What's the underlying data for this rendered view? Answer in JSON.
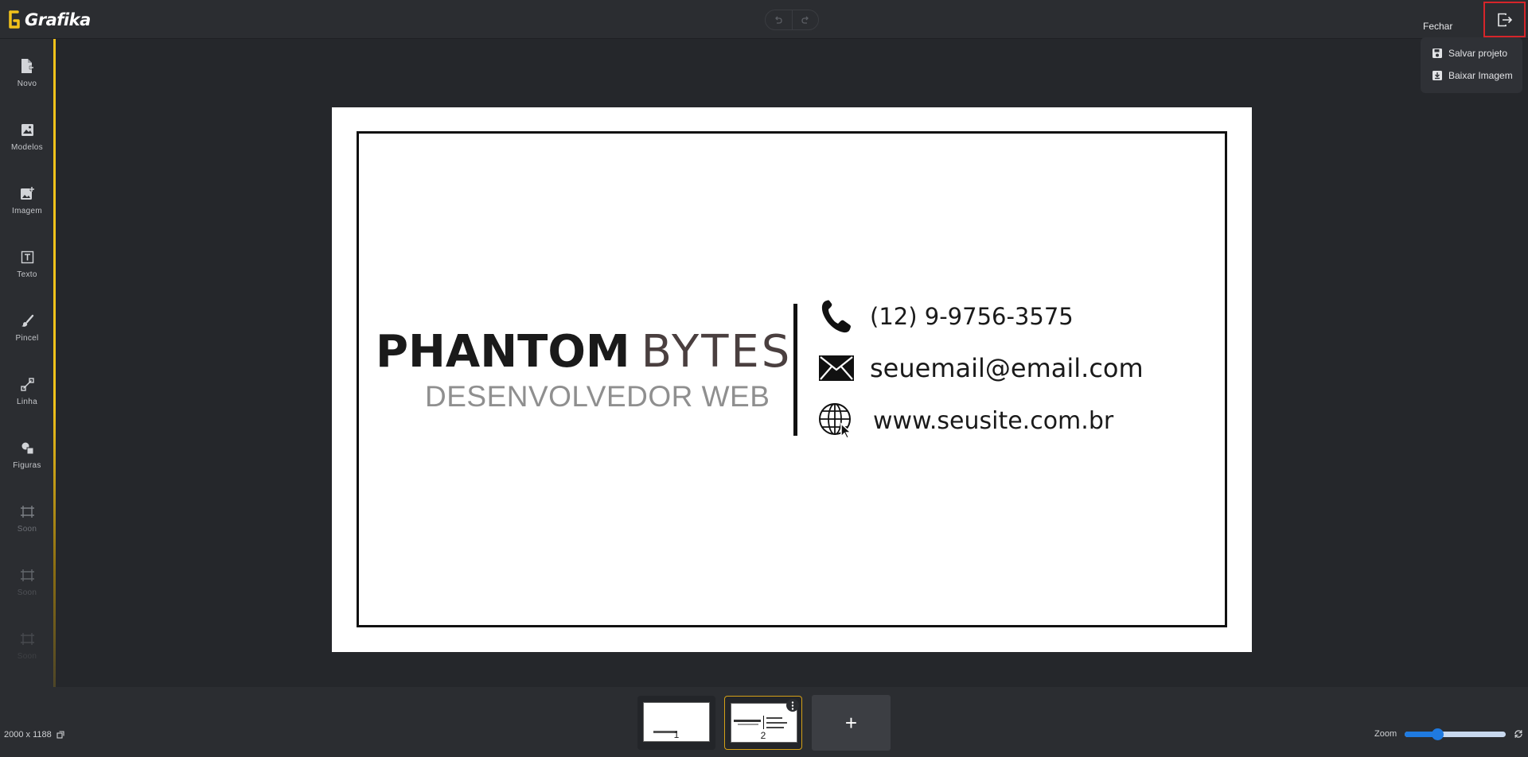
{
  "app": {
    "name": "Grafika"
  },
  "header": {
    "undo_icon": "undo-icon",
    "redo_icon": "redo-icon",
    "close_label": "Fechar",
    "exit_icon": "exit-icon"
  },
  "file_menu": {
    "items": [
      {
        "label": "Salvar projeto",
        "icon": "save-icon"
      },
      {
        "label": "Baixar Imagem",
        "icon": "download-icon"
      }
    ]
  },
  "sidebar": {
    "items": [
      {
        "label": "Novo",
        "icon": "new-file-icon"
      },
      {
        "label": "Modelos",
        "icon": "templates-icon"
      },
      {
        "label": "Imagem",
        "icon": "add-image-icon"
      },
      {
        "label": "Texto",
        "icon": "text-icon"
      },
      {
        "label": "Pincel",
        "icon": "brush-icon"
      },
      {
        "label": "Linha",
        "icon": "line-icon"
      },
      {
        "label": "Figuras",
        "icon": "shapes-icon"
      },
      {
        "label": "Soon",
        "icon": "frame-icon"
      },
      {
        "label": "Soon",
        "icon": "frame-icon"
      },
      {
        "label": "Soon",
        "icon": "frame-icon"
      }
    ]
  },
  "card": {
    "brand_primary": "PHANTOM",
    "brand_secondary": "BYTES",
    "subtitle": "DESENVOLVEDOR WEB",
    "phone": "(12) 9-9756-3575",
    "email": "seuemail@email.com",
    "website": "www.seusite.com.br",
    "colors": {
      "text": "#1a1a1a",
      "secondary": "#4a3f3f",
      "subtitle": "#8f8f8f"
    }
  },
  "footer": {
    "canvas_size": "2000 x 1188",
    "pages": [
      {
        "number": "1"
      },
      {
        "number": "2"
      }
    ],
    "active_page": "2",
    "add_page_label": "+",
    "zoom_label": "Zoom",
    "zoom_level": 0.3
  },
  "colors": {
    "accent": "#f2c21b",
    "highlight_border": "#d6252a",
    "zoom": "#1f7ae0"
  }
}
